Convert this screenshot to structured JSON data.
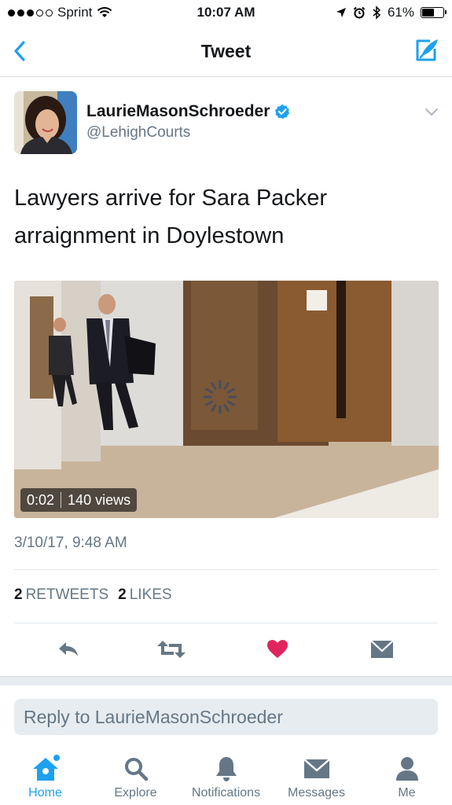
{
  "status_bar": {
    "carrier": "Sprint",
    "time": "10:07 AM",
    "battery": "61%",
    "battery_level": 0.61,
    "icons": [
      "signal-dots-icon",
      "wifi-icon",
      "location-arrow-icon",
      "alarm-icon",
      "bluetooth-icon",
      "battery-icon"
    ]
  },
  "nav": {
    "title": "Tweet",
    "back_icon": "chevron-left-icon",
    "compose_icon": "compose-tweet-icon"
  },
  "tweet": {
    "author_name": "LaurieMasonSchroeder",
    "author_handle": "@LehighCourts",
    "verified": true,
    "text_line1": "Lawyers arrive for Sara Packer",
    "text_line2": "arraignment in Doylestown",
    "media": {
      "duration": "0:02",
      "views": "140 views",
      "loading": true
    },
    "timestamp": "3/10/17, 9:48 AM",
    "retweets_count": "2",
    "retweets_label": "RETWEETS",
    "likes_count": "2",
    "likes_label": "LIKES"
  },
  "actions": [
    {
      "name": "reply",
      "icon": "reply-icon"
    },
    {
      "name": "retweet",
      "icon": "retweet-icon"
    },
    {
      "name": "like",
      "icon": "heart-icon",
      "liked": true
    },
    {
      "name": "share",
      "icon": "envelope-icon"
    }
  ],
  "reply_box": {
    "placeholder": "Reply to LaurieMasonSchroeder"
  },
  "tabs": [
    {
      "label": "Home",
      "icon": "home-icon",
      "active": true,
      "has_new": true
    },
    {
      "label": "Explore",
      "icon": "search-icon",
      "active": false
    },
    {
      "label": "Notifications",
      "icon": "bell-icon",
      "active": false
    },
    {
      "label": "Messages",
      "icon": "envelope-icon",
      "active": false
    },
    {
      "label": "Me",
      "icon": "person-icon",
      "active": false
    }
  ],
  "colors": {
    "accent": "#1da1f2",
    "like": "#e0245e",
    "icon_gray": "#657786",
    "text": "#14171a"
  }
}
